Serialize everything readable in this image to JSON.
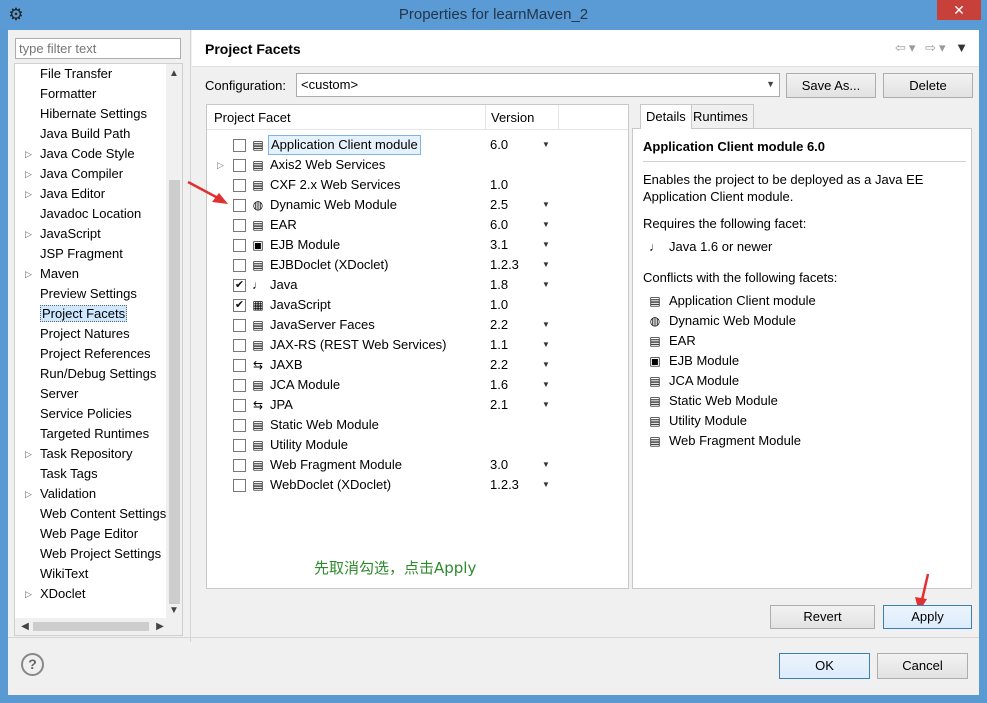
{
  "window": {
    "title": "Properties for learnMaven_2",
    "close_glyph": "✕"
  },
  "filter": {
    "placeholder": "type filter text"
  },
  "nav": {
    "items": [
      {
        "label": "File Transfer",
        "expandable": false
      },
      {
        "label": "Formatter",
        "expandable": false
      },
      {
        "label": "Hibernate Settings",
        "expandable": false
      },
      {
        "label": "Java Build Path",
        "expandable": false
      },
      {
        "label": "Java Code Style",
        "expandable": true
      },
      {
        "label": "Java Compiler",
        "expandable": true
      },
      {
        "label": "Java Editor",
        "expandable": true
      },
      {
        "label": "Javadoc Location",
        "expandable": false
      },
      {
        "label": "JavaScript",
        "expandable": true
      },
      {
        "label": "JSP Fragment",
        "expandable": false
      },
      {
        "label": "Maven",
        "expandable": true
      },
      {
        "label": "Preview Settings",
        "expandable": false
      },
      {
        "label": "Project Facets",
        "expandable": false,
        "selected": true
      },
      {
        "label": "Project Natures",
        "expandable": false
      },
      {
        "label": "Project References",
        "expandable": false
      },
      {
        "label": "Run/Debug Settings",
        "expandable": false
      },
      {
        "label": "Server",
        "expandable": false
      },
      {
        "label": "Service Policies",
        "expandable": false
      },
      {
        "label": "Targeted Runtimes",
        "expandable": false
      },
      {
        "label": "Task Repository",
        "expandable": true
      },
      {
        "label": "Task Tags",
        "expandable": false
      },
      {
        "label": "Validation",
        "expandable": true
      },
      {
        "label": "Web Content Settings",
        "expandable": false
      },
      {
        "label": "Web Page Editor",
        "expandable": false
      },
      {
        "label": "Web Project Settings",
        "expandable": false
      },
      {
        "label": "WikiText",
        "expandable": false
      },
      {
        "label": "XDoclet",
        "expandable": true
      }
    ]
  },
  "page": {
    "title": "Project Facets",
    "configuration_label": "Configuration:",
    "configuration_value": "<custom>",
    "save_as_label": "Save As...",
    "delete_label": "Delete"
  },
  "facet_table": {
    "col_facet": "Project Facet",
    "col_version": "Version",
    "rows": [
      {
        "name": "Application Client module",
        "version": "6.0",
        "checked": false,
        "dropdown": true,
        "icon": "page-icon",
        "selected": true
      },
      {
        "name": "Axis2 Web Services",
        "version": "",
        "checked": false,
        "dropdown": false,
        "icon": "page-icon",
        "expandable": true
      },
      {
        "name": "CXF 2.x Web Services",
        "version": "1.0",
        "checked": false,
        "dropdown": false,
        "icon": "page-icon"
      },
      {
        "name": "Dynamic Web Module",
        "version": "2.5",
        "checked": false,
        "dropdown": true,
        "icon": "globe-icon"
      },
      {
        "name": "EAR",
        "version": "6.0",
        "checked": false,
        "dropdown": true,
        "icon": "page-icon"
      },
      {
        "name": "EJB Module",
        "version": "3.1",
        "checked": false,
        "dropdown": true,
        "icon": "bean-icon"
      },
      {
        "name": "EJBDoclet (XDoclet)",
        "version": "1.2.3",
        "checked": false,
        "dropdown": true,
        "icon": "page-icon"
      },
      {
        "name": "Java",
        "version": "1.8",
        "checked": true,
        "dropdown": true,
        "icon": "java-icon"
      },
      {
        "name": "JavaScript",
        "version": "1.0",
        "checked": true,
        "dropdown": false,
        "icon": "js-icon"
      },
      {
        "name": "JavaServer Faces",
        "version": "2.2",
        "checked": false,
        "dropdown": true,
        "icon": "page-icon"
      },
      {
        "name": "JAX-RS (REST Web Services)",
        "version": "1.1",
        "checked": false,
        "dropdown": true,
        "icon": "page-icon"
      },
      {
        "name": "JAXB",
        "version": "2.2",
        "checked": false,
        "dropdown": true,
        "icon": "arrows-icon"
      },
      {
        "name": "JCA Module",
        "version": "1.6",
        "checked": false,
        "dropdown": true,
        "icon": "page-icon"
      },
      {
        "name": "JPA",
        "version": "2.1",
        "checked": false,
        "dropdown": true,
        "icon": "arrows-icon"
      },
      {
        "name": "Static Web Module",
        "version": "",
        "checked": false,
        "dropdown": false,
        "icon": "page-icon"
      },
      {
        "name": "Utility Module",
        "version": "",
        "checked": false,
        "dropdown": false,
        "icon": "page-icon"
      },
      {
        "name": "Web Fragment Module",
        "version": "3.0",
        "checked": false,
        "dropdown": true,
        "icon": "page-icon"
      },
      {
        "name": "WebDoclet (XDoclet)",
        "version": "1.2.3",
        "checked": false,
        "dropdown": true,
        "icon": "page-icon"
      }
    ]
  },
  "details": {
    "tab_details": "Details",
    "tab_runtimes": "Runtimes",
    "title": "Application Client module 6.0",
    "description": "Enables the project to be deployed as a Java EE Application Client module.",
    "requires_label": "Requires the following facet:",
    "requires": [
      {
        "name": "Java 1.6 or newer",
        "icon": "java-icon"
      }
    ],
    "conflicts_label": "Conflicts with the following facets:",
    "conflicts": [
      {
        "name": "Application Client module",
        "icon": "page-icon"
      },
      {
        "name": "Dynamic Web Module",
        "icon": "globe-icon"
      },
      {
        "name": "EAR",
        "icon": "page-icon"
      },
      {
        "name": "EJB Module",
        "icon": "bean-icon"
      },
      {
        "name": "JCA Module",
        "icon": "page-icon"
      },
      {
        "name": "Static Web Module",
        "icon": "page-icon"
      },
      {
        "name": "Utility Module",
        "icon": "page-icon"
      },
      {
        "name": "Web Fragment Module",
        "icon": "page-icon"
      }
    ]
  },
  "annotation": "先取消勾选，点击Apply",
  "buttons": {
    "revert": "Revert",
    "apply": "Apply",
    "ok": "OK",
    "cancel": "Cancel",
    "help": "?"
  },
  "icons": {
    "page-icon": "▤",
    "globe-icon": "◍",
    "bean-icon": "▣",
    "java-icon": "♩",
    "js-icon": "▦",
    "arrows-icon": "⇆"
  },
  "colors": {
    "titlebar": "#5b9bd5",
    "close": "#c7413a",
    "annotation": "#2f8a2f",
    "arrow": "#e03030"
  }
}
